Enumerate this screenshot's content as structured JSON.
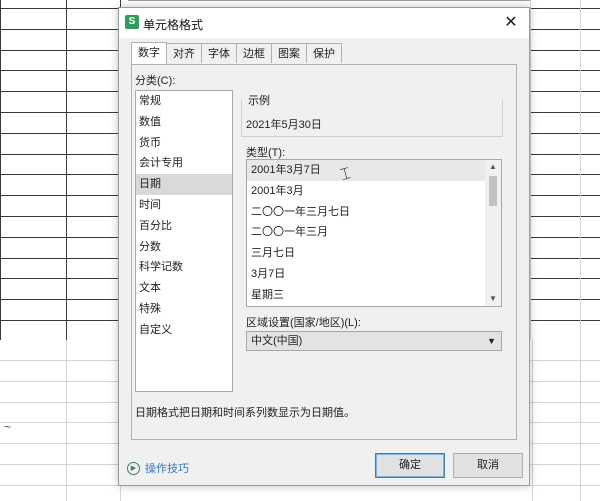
{
  "dialog": {
    "icon_letter": "S",
    "title": "单元格格式",
    "close": "✕"
  },
  "tabs": [
    "数字",
    "对齐",
    "字体",
    "边框",
    "图案",
    "保护"
  ],
  "category": {
    "label": "分类(C):",
    "items": [
      "常规",
      "数值",
      "货币",
      "会计专用",
      "日期",
      "时间",
      "百分比",
      "分数",
      "科学记数",
      "文本",
      "特殊",
      "自定义"
    ],
    "selected": "日期"
  },
  "sample": {
    "label": "示例",
    "value": "2021年5月30日"
  },
  "type": {
    "label": "类型(T):",
    "items": [
      "2001年3月7日",
      "2001年3月",
      "二〇〇一年三月七日",
      "二〇〇一年三月",
      "三月七日",
      "3月7日",
      "星期三"
    ],
    "selected": "2001年3月7日"
  },
  "region": {
    "label": "区域设置(国家/地区)(L):",
    "value": "中文(中国)"
  },
  "description": "日期格式把日期和时间系列数显示为日期值。",
  "footer": {
    "tips": "操作技巧",
    "ok": "确定",
    "cancel": "取消"
  },
  "sheet": {
    "tilde": "~"
  }
}
